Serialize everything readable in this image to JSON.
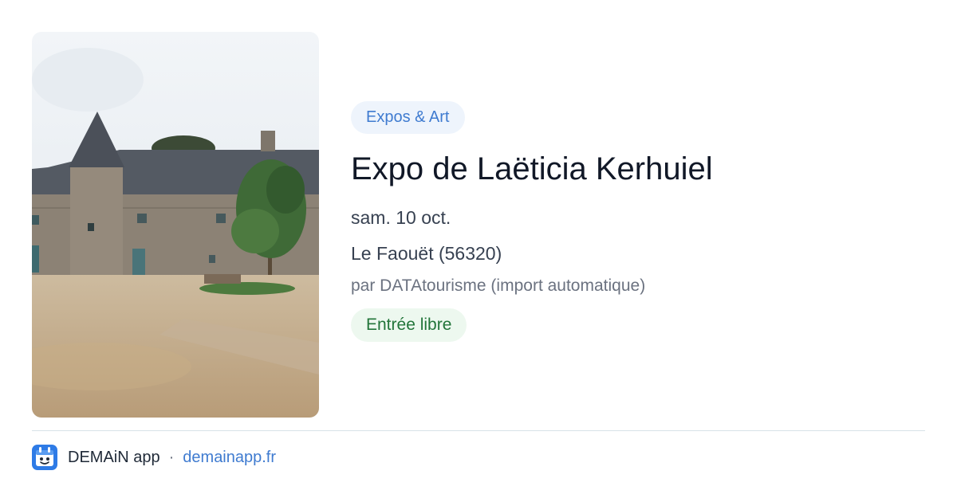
{
  "event": {
    "category": "Expos & Art",
    "title": "Expo de Laëticia Kerhuiel",
    "date": "sam. 10 oct.",
    "location": "Le Faouët (56320)",
    "source": "par DATAtourisme (import automatique)",
    "price": "Entrée libre"
  },
  "footer": {
    "app_name": "DEMAiN app",
    "separator": "·",
    "app_url": "demainapp.fr"
  },
  "colors": {
    "accent": "#3f7bd0",
    "category_bg": "#eef4fc",
    "price_text": "#22753a",
    "price_bg": "#edf8ef"
  }
}
